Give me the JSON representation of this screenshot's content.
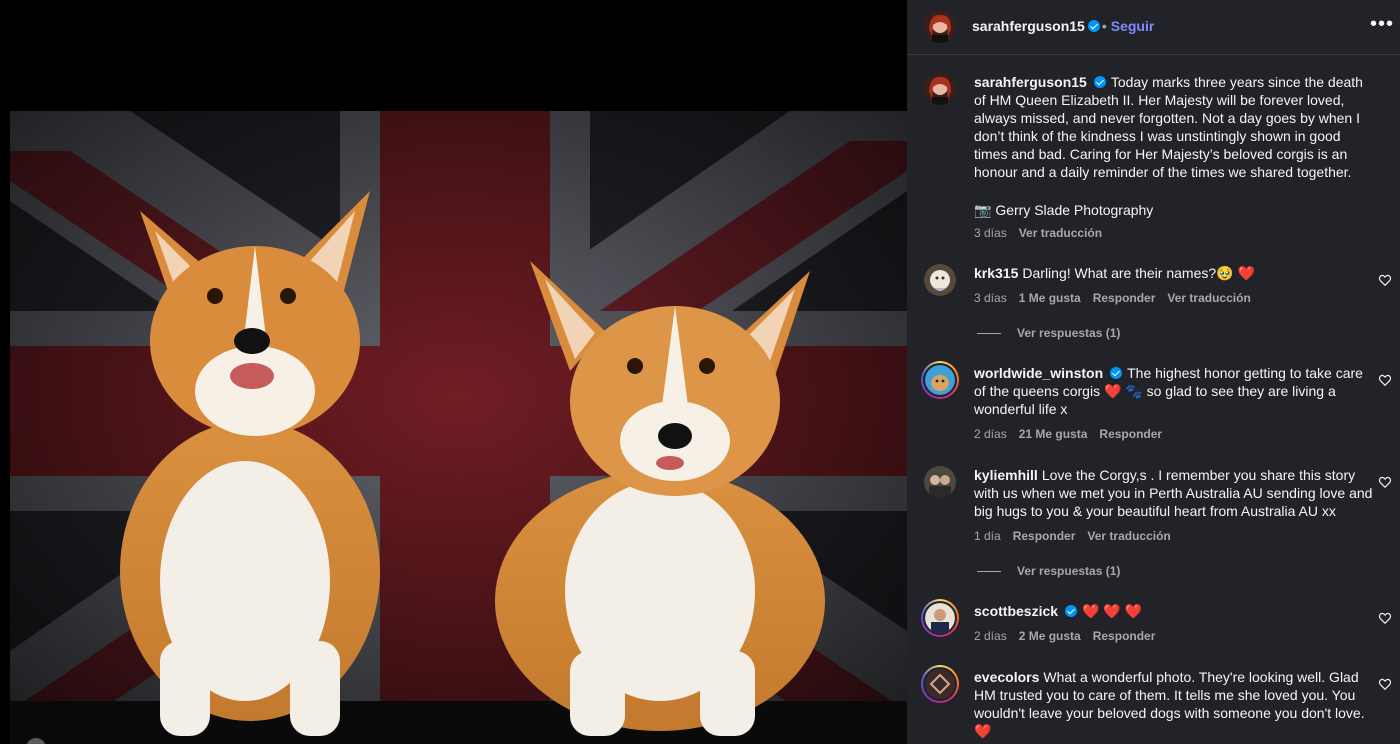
{
  "post": {
    "author": "sarahferguson15",
    "follow_label": "Seguir",
    "dot": "•",
    "more_label": "•••"
  },
  "caption": {
    "username": "sarahferguson15",
    "text": "Today marks three years since the death of HM Queen Elizabeth II. Her Majesty will be forever loved, always missed, and never forgotten. Not a day goes by when I don’t think of the kindness I was unstintingly shown in good times and bad. Caring for Her Majesty’s beloved corgis is an honour and a daily reminder of the times we shared together.",
    "credit_icon": "📷",
    "credit": "Gerry Slade Photography",
    "time": "3 días",
    "translate": "Ver traducción"
  },
  "comments": [
    {
      "username": "krk315",
      "text": "Darling! What are their names?🥹 ❤️",
      "time": "3 días",
      "likes": "1 Me gusta",
      "reply": "Responder",
      "translate": "Ver traducción",
      "view_replies": "Ver respuestas (1)"
    },
    {
      "username": "worldwide_winston",
      "text": "The highest honor getting to take care of the queens corgis ❤️ 🐾 so glad to see they are living a wonderful life x",
      "time": "2 días",
      "likes": "21 Me gusta",
      "reply": "Responder"
    },
    {
      "username": "kyliemhill",
      "text": "Love the Corgy,s . I remember you share this story with us when we met you in Perth Australia AU sending love and big hugs to you & your beautiful heart from Australia AU xx",
      "time": "1 día",
      "reply": "Responder",
      "translate": "Ver traducción",
      "view_replies": "Ver respuestas (1)"
    },
    {
      "username": "scottbeszick",
      "text": "❤️ ❤️ ❤️",
      "time": "2 días",
      "likes": "2 Me gusta",
      "reply": "Responder"
    },
    {
      "username": "evecolors",
      "text": "What a wonderful photo. They're looking well. Glad HM trusted you to care of them. It tells me she loved you. You wouldn't leave your beloved dogs with someone you don't love. ❤️"
    }
  ],
  "colors": {
    "panel_bg": "#212328",
    "link": "#7b8cff",
    "verified": "#0095f6",
    "muted": "#a8a8a8"
  },
  "icons": [
    "verified-badge-icon",
    "more-options-icon",
    "heart-outline-icon",
    "camera-icon"
  ]
}
